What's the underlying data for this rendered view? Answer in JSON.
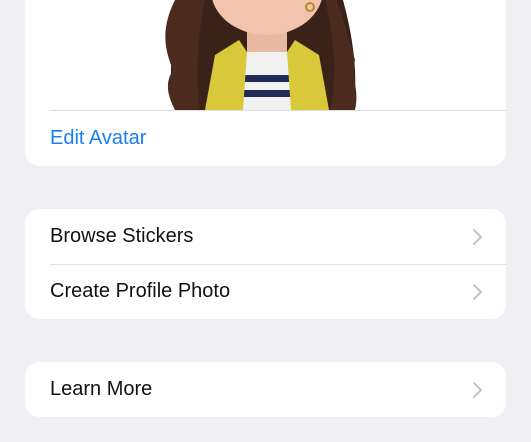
{
  "avatar_card": {
    "edit_label": "Edit Avatar"
  },
  "options": {
    "browse_stickers": "Browse Stickers",
    "create_profile_photo": "Create Profile Photo"
  },
  "info": {
    "learn_more": "Learn More"
  },
  "colors": {
    "link": "#1b7ef4",
    "background": "#efeff4",
    "chevron": "#c4c4c8"
  },
  "icons": {
    "row_chevron": "chevron-right-icon"
  }
}
